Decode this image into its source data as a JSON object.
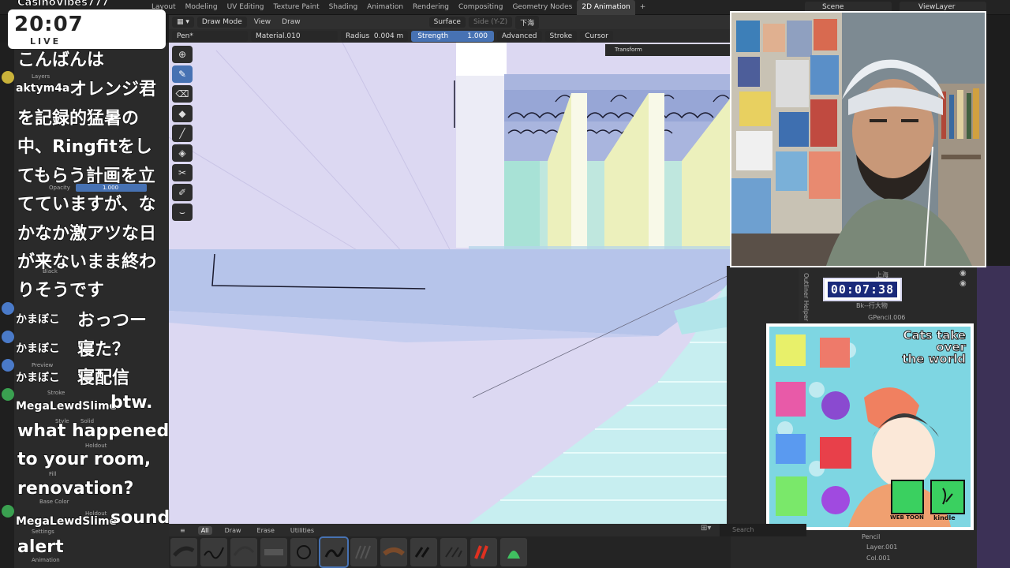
{
  "stream": {
    "channel": "CasinoVibes777",
    "clock": "20:07",
    "live_label": "LIVE",
    "timer": "00:07:38"
  },
  "workspace_tabs": [
    "Layout",
    "Modeling",
    "UV Editing",
    "Texture Paint",
    "Shading",
    "Animation",
    "Rendering",
    "Compositing",
    "Geometry Nodes",
    "2D Animation"
  ],
  "active_workspace": "2D Animation",
  "scene": "Scene",
  "view_layer": "ViewLayer",
  "header": {
    "mode": "Draw Mode",
    "view": "View",
    "draw": "Draw",
    "surface": "Surface",
    "side": "Side (Y-Z)",
    "layer_name": "下海"
  },
  "tool_settings": {
    "brush": "Pen*",
    "material": "Material.010",
    "radius_label": "Radius",
    "radius_value": "0.004 m",
    "strength_label": "Strength",
    "strength_value": "1.000",
    "advanced": "Advanced",
    "stroke": "Stroke",
    "cursor": "Cursor"
  },
  "transform_tab": "Transform",
  "shelf": {
    "tabs": [
      "All",
      "Draw",
      "Erase",
      "Utilities"
    ],
    "active_tab": "All",
    "search_placeholder": "Search"
  },
  "outliner": {
    "tab_label": "Outliner Helper",
    "rows": [
      "上海",
      "Bk--行大物",
      "GPencil.006",
      "Pencil",
      "Layer.001",
      "Col.001"
    ]
  },
  "properties": {
    "layers": "Layers",
    "opacity_label": "Opacity",
    "opacity_value": "1.000",
    "black": "Black",
    "preview": "Preview",
    "stroke": "Stroke",
    "style_label": "Style",
    "style_value": "Solid",
    "holdout": "Holdout",
    "fill": "Fill",
    "base_color": "Base Color",
    "settings": "Settings",
    "animation": "Animation"
  },
  "chat": [
    {
      "user": "",
      "text": "こんばんは"
    },
    {
      "user": "aktym4a",
      "text": "オレンジ君"
    },
    {
      "user": "",
      "text": "を記録的猛暑の"
    },
    {
      "user": "",
      "text": "中、Ringfitをし"
    },
    {
      "user": "",
      "text": "てもらう計画を立"
    },
    {
      "user": "",
      "text": "てていますが、な"
    },
    {
      "user": "",
      "text": "かなか激アツな日"
    },
    {
      "user": "",
      "text": "が来ないまま終わ"
    },
    {
      "user": "",
      "text": "りそうです"
    },
    {
      "user": "かまぼこ",
      "text": "おっつー"
    },
    {
      "user": "かまぼこ",
      "text": "寝た？"
    },
    {
      "user": "かまぼこ",
      "text": "寝配信"
    },
    {
      "user": "MegaLewdSlime",
      "text": "btw."
    },
    {
      "user": "",
      "text": "what happened"
    },
    {
      "user": "",
      "text": "to your room,"
    },
    {
      "user": "",
      "text": "renovation?"
    },
    {
      "user": "MegaLewdSlime",
      "text": "sound"
    },
    {
      "user": "",
      "text": "alert"
    }
  ],
  "ad": {
    "title_line1": "Cats take",
    "title_line2": "over",
    "title_line3": "the world",
    "badge1": "WEB TOON",
    "badge2": "kindle"
  },
  "colors": {
    "accent": "#4772b3",
    "viewport_bg": "#dcd8f2",
    "panel": "#2a2a2a"
  }
}
